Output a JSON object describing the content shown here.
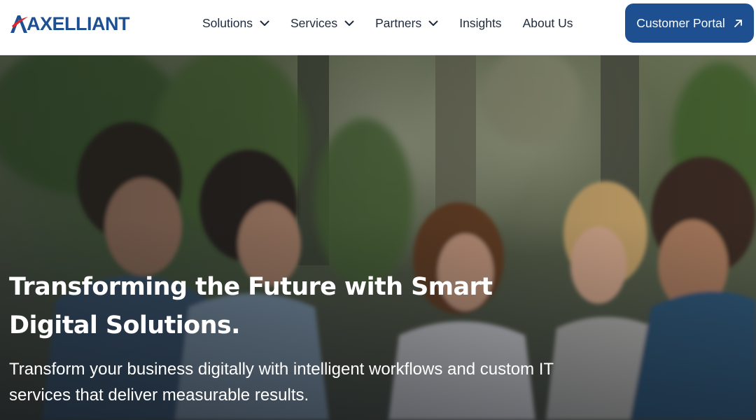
{
  "header": {
    "logo_text": "AXELLIANT",
    "nav": [
      {
        "label": "Solutions",
        "has_dropdown": true
      },
      {
        "label": "Services",
        "has_dropdown": true
      },
      {
        "label": "Partners",
        "has_dropdown": true
      },
      {
        "label": "Insights",
        "has_dropdown": false
      },
      {
        "label": "About Us",
        "has_dropdown": false
      }
    ],
    "portal_button": {
      "label": "Customer Portal",
      "icon": "arrow-up-right-icon"
    }
  },
  "hero": {
    "title": "Transforming the Future with Smart Digital Solutions.",
    "subtitle": "Transform your business digitally with intelligent workflows and custom IT services that deliver measurable results."
  },
  "colors": {
    "brand_blue": "#1d4f91",
    "logo_red": "#e0262b",
    "nav_text": "#1f2a3c",
    "hero_text": "#ffffff"
  }
}
